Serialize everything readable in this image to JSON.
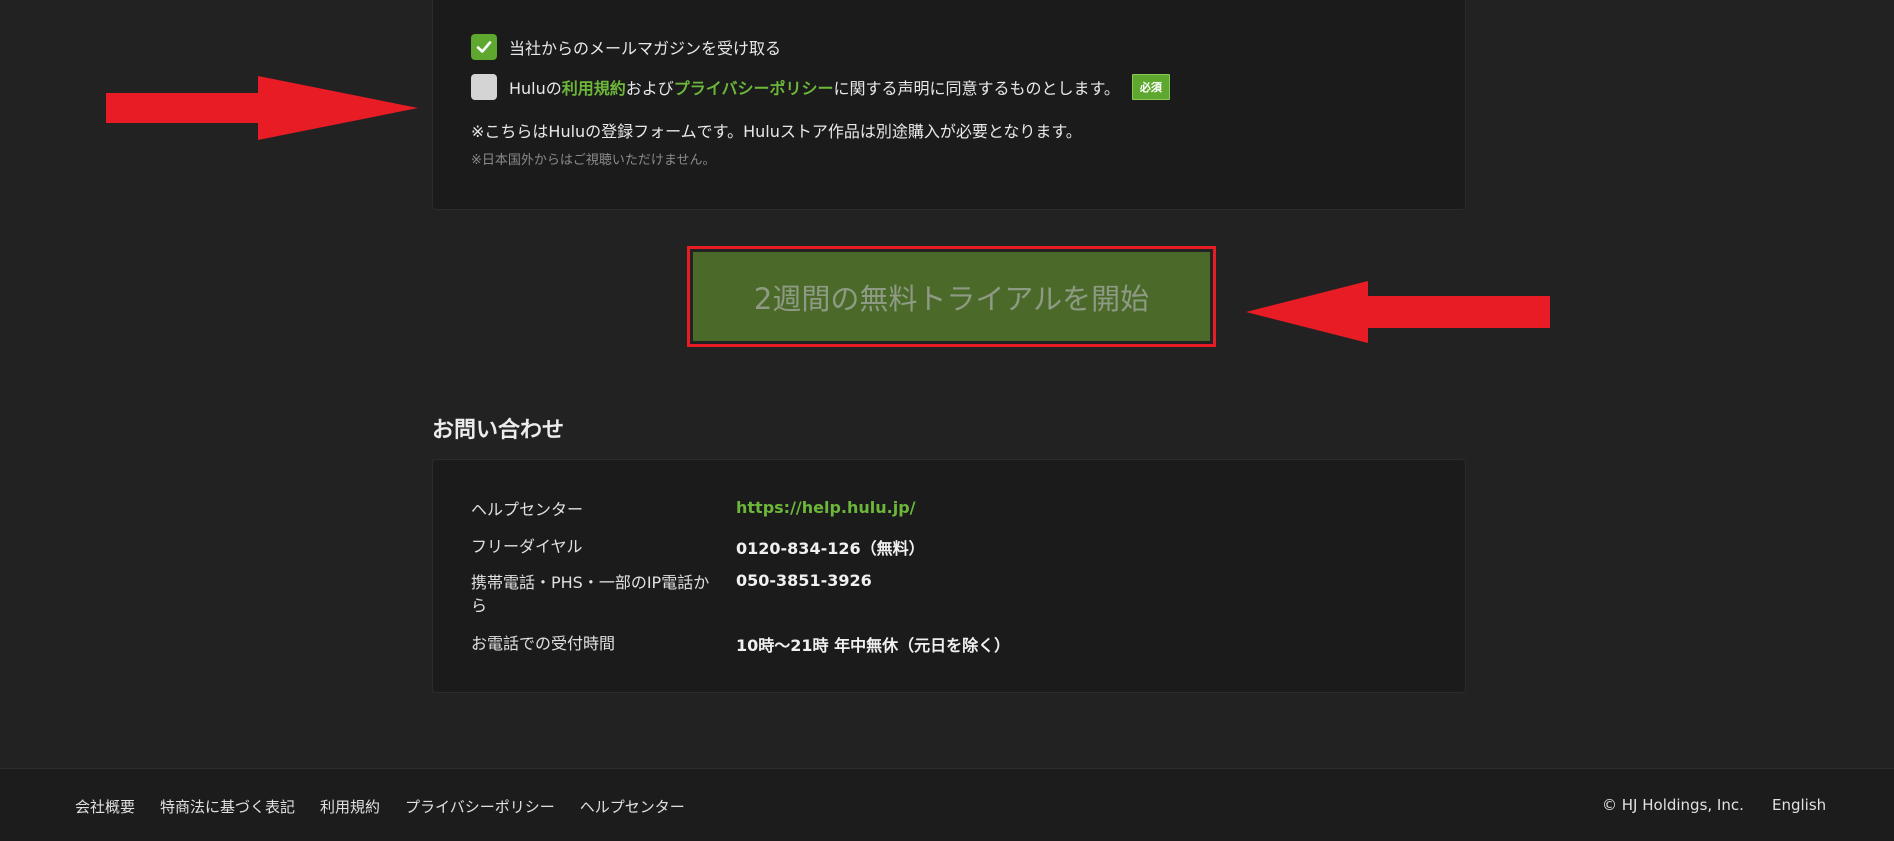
{
  "form": {
    "newsletter_label": "当社からのメールマガジンを受け取る",
    "newsletter_checked": true,
    "terms": {
      "part1": "Huluの",
      "terms_link": "利用規約",
      "part2": "および",
      "privacy_link": "プライバシーポリシー",
      "part3": "に関する声明に同意するものとします。",
      "checked": false
    },
    "required_badge": "必須",
    "note_main": "※こちらはHuluの登録フォームです。Huluストア作品は別途購入が必要となります。",
    "note_sub": "※日本国外からはご視聴いただけません。"
  },
  "trial_button": {
    "label": "2週間の無料トライアルを開始"
  },
  "contact": {
    "heading": "お問い合わせ",
    "rows": [
      {
        "label": "ヘルプセンター",
        "value": "https://help.hulu.jp/"
      },
      {
        "label": "フリーダイヤル",
        "value": "0120-834-126（無料）"
      },
      {
        "label": "携帯電話・PHS・一部のIP電話から",
        "value": "050-3851-3926"
      },
      {
        "label": "お電話での受付時間",
        "value": "10時～21時 年中無休（元日を除く）"
      }
    ]
  },
  "footer": {
    "links": [
      "会社概要",
      "特商法に基づく表記",
      "利用規約",
      "プライバシーポリシー",
      "ヘルプセンター"
    ],
    "copyright": "© HJ Holdings, Inc.",
    "language": "English"
  },
  "colors": {
    "background": "#222222",
    "panel": "#1b1b1b",
    "accent_green": "#6cb63a",
    "checkbox_green": "#5fa830",
    "button_green": "#4b6a2a",
    "annotation_red": "#e81c24"
  },
  "icons": {
    "checkmark": "check-icon",
    "annotation_arrows": "arrow-right-icon, arrow-left-icon"
  }
}
